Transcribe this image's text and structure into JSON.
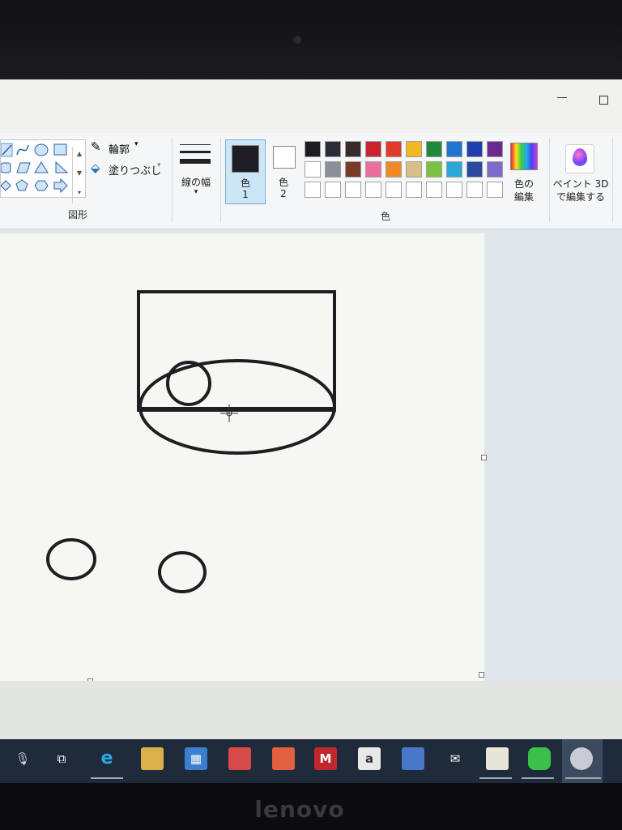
{
  "ribbon": {
    "shapes_group_label": "図形",
    "outline_label": "輪郭",
    "fill_label": "塗りつぶし",
    "line_width_label": "線の幅",
    "color1_label": "色",
    "color1_num": "1",
    "color2_label": "色",
    "color2_num": "2",
    "colors_group_label": "色",
    "edit_colors_label_1": "色の",
    "edit_colors_label_2": "編集",
    "paint3d_label_1": "ペイント 3D",
    "paint3d_label_2": "で編集する"
  },
  "palette": {
    "row1": [
      "#1c1c20",
      "#2b2d36",
      "#3a2a2a",
      "#c8232e",
      "#e13b2e",
      "#f1b91f",
      "#1f8a3a",
      "#1e74d0",
      "#1f3fae",
      "#6d2a8e"
    ],
    "row2": [
      "#ffffff",
      "#8a8f9a",
      "#7a3a2a",
      "#e8709a",
      "#f08a28",
      "#d6bf88",
      "#7cc242",
      "#2aa8d8",
      "#2a4aa0",
      "#7a6cc8"
    ],
    "row3": [
      "#ffffff",
      "#ffffff",
      "#ffffff",
      "#ffffff",
      "#ffffff",
      "#ffffff",
      "#ffffff",
      "#ffffff",
      "#ffffff",
      "#ffffff"
    ]
  },
  "primary_color": "#1e1e24",
  "secondary_color": "#ffffff",
  "taskbar": {
    "amazon_glyph": "a"
  },
  "laptop_brand": "lenovo"
}
